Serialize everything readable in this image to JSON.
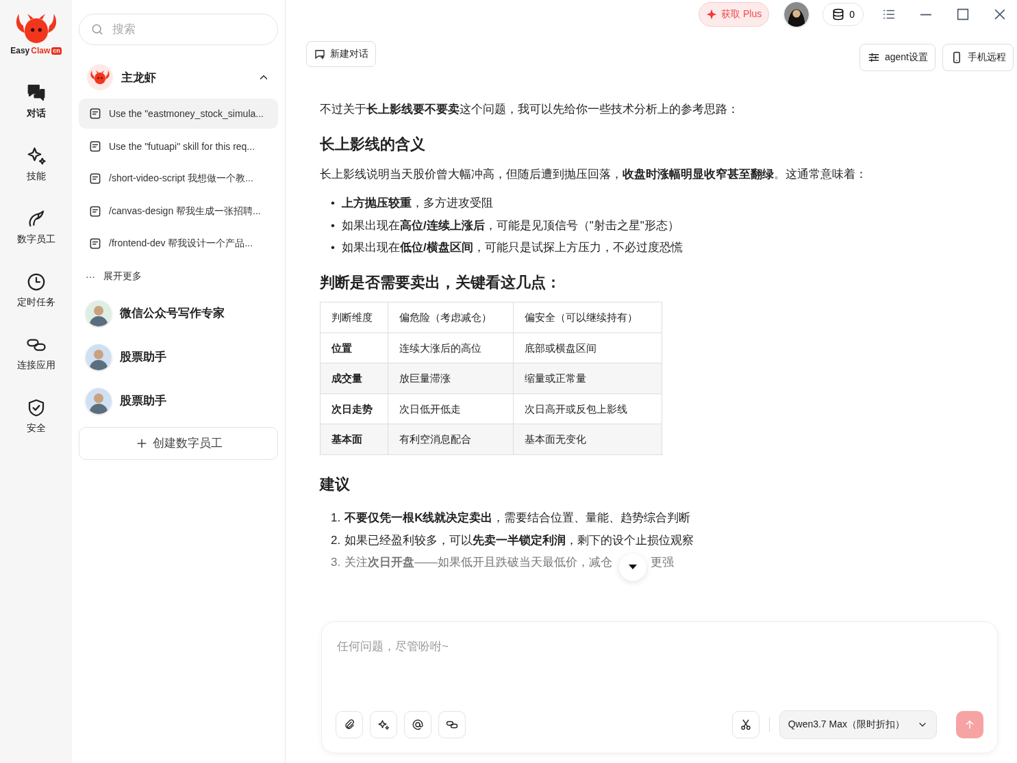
{
  "logo": {
    "word_dark": "Easy",
    "word_red": "Claw",
    "badge": "cn"
  },
  "rail": [
    {
      "label": "对话",
      "selected": true
    },
    {
      "label": "技能",
      "selected": false
    },
    {
      "label": "数字员工",
      "selected": false
    },
    {
      "label": "定时任务",
      "selected": false
    },
    {
      "label": "连接应用",
      "selected": false
    },
    {
      "label": "安全",
      "selected": false
    }
  ],
  "sidebar": {
    "search": {
      "placeholder": "搜索"
    },
    "group": {
      "name": "主龙虾",
      "expanded": true,
      "conversations": [
        {
          "title": "Use the \"eastmoney_stock_simula...",
          "selected": true
        },
        {
          "title": "Use the \"futuapi\" skill for this req...",
          "selected": false
        },
        {
          "title": "/short-video-script 我想做一个教...",
          "selected": false
        },
        {
          "title": "/canvas-design 帮我生成一张招聘...",
          "selected": false
        },
        {
          "title": "/frontend-dev 帮我设计一个产品...",
          "selected": false
        }
      ],
      "more": {
        "icon": "···",
        "label": "展开更多"
      }
    },
    "agents": [
      {
        "name": "微信公众号写作专家"
      },
      {
        "name": "股票助手"
      },
      {
        "name": "股票助手"
      }
    ],
    "create_button": "创建数字员工"
  },
  "topbar": {
    "plus_button": "获取 Plus",
    "credits": "0"
  },
  "new_chat_button": "新建对话",
  "actions": [
    "agent设置",
    "手机远程"
  ],
  "message": {
    "intro": "不过关于**长上影线要不要卖**这个问题，我可以先给你一些技术分析上的参考思路：",
    "section1": {
      "heading": "长上影线的含义",
      "text": "长上影线说明当天股价曾大幅冲高，但随后遭到抛压回落，**收盘时涨幅明显收窄甚至翻绿**。这通常意味着：",
      "bullets": [
        {
          "marker": "•",
          "text": "**上方抛压较重**，多方进攻受阻"
        },
        {
          "marker": "•",
          "text": "如果出现在**高位/连续上涨后**，可能是见顶信号（\"射击之星\"形态）"
        },
        {
          "marker": "•",
          "text": "如果出现在**低位/横盘区间**，可能只是试探上方压力，不必过度恐慌"
        }
      ]
    },
    "section2": {
      "heading": "判断是否需要卖出，关键看这几点：",
      "table": {
        "columns": [
          "判断维度",
          "偏危险（考虑减仓）",
          "偏安全（可以继续持有）"
        ],
        "rows": [
          [
            "位置",
            "连续大涨后的高位",
            "底部或横盘区间"
          ],
          [
            "成交量",
            "放巨量滞涨",
            "缩量或正常量"
          ],
          [
            "次日走势",
            "次日低开低走",
            "次日高开或反包上影线"
          ],
          [
            "基本面",
            "有利空消息配合",
            "基本面无变化"
          ]
        ]
      }
    },
    "section3": {
      "heading": "建议",
      "items": [
        {
          "number": "1.",
          "text": "**不要仅凭一根K线就决定卖出**，需要结合位置、量能、趋势综合判断"
        },
        {
          "number": "2.",
          "text": "如果已经盈利较多，可以**先卖一半锁定利润**，剩下的设个止损位观察"
        },
        {
          "number": "3.",
          "text": "关注**次日开盘**——如果低开且跌破当天最低价，减仓",
          "tail": "更强"
        }
      ]
    }
  },
  "composer": {
    "placeholder": "任何问题，尽管吩咐~",
    "model": "Qwen3.7 Max（限时折扣）"
  }
}
